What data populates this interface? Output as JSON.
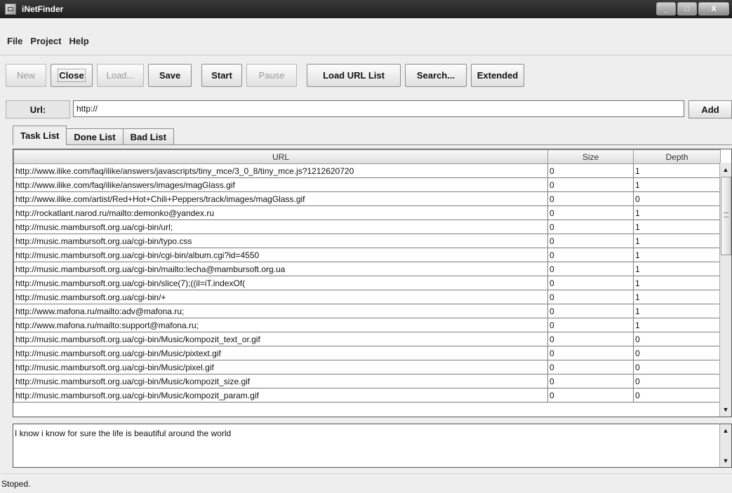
{
  "window": {
    "title": "iNetFinder",
    "minimize_glyph": "_",
    "maximize_glyph": "□",
    "close_glyph": "X"
  },
  "menu": [
    "File",
    "Project",
    "Help"
  ],
  "toolbar": {
    "new": "New",
    "close": "Close",
    "load": "Load...",
    "save": "Save",
    "start": "Start",
    "pause": "Pause",
    "load_url_list": "Load URL List",
    "search": "Search...",
    "extended": "Extended"
  },
  "url": {
    "label": "Url:",
    "value": "http://",
    "add": "Add"
  },
  "tabs": [
    "Task List",
    "Done List",
    "Bad List"
  ],
  "table": {
    "columns": [
      "URL",
      "Size",
      "Depth"
    ],
    "rows": [
      [
        "http://www.ilike.com/faq/ilike/answers/javascripts/tiny_mce/3_0_8/tiny_mce.js?1212620720",
        "0",
        "1"
      ],
      [
        "http://www.ilike.com/faq/ilike/answers/images/magGlass.gif",
        "0",
        "1"
      ],
      [
        "http://www.ilike.com/artist/Red+Hot+Chili+Peppers/track/images/magGlass.gif",
        "0",
        "0"
      ],
      [
        "http://rockatlant.narod.ru/mailto:demonko@yandex.ru",
        "0",
        "1"
      ],
      [
        "http://music.mambursoft.org.ua/cgi-bin/url;",
        "0",
        "1"
      ],
      [
        "http://music.mambursoft.org.ua/cgi-bin/typo.css",
        "0",
        "1"
      ],
      [
        "http://music.mambursoft.org.ua/cgi-bin/cgi-bin/album.cgi?id=4550",
        "0",
        "1"
      ],
      [
        "http://music.mambursoft.org.ua/cgi-bin/mailto:lecha@mambursoft.org.ua",
        "0",
        "1"
      ],
      [
        "http://music.mambursoft.org.ua/cgi-bin/slice(7);((il=iT.indexOf(",
        "0",
        "1"
      ],
      [
        "http://music.mambursoft.org.ua/cgi-bin/+",
        "0",
        "1"
      ],
      [
        "http://www.mafona.ru/mailto:adv@mafona.ru;",
        "0",
        "1"
      ],
      [
        "http://www.mafona.ru/mailto:support@mafona.ru;",
        "0",
        "1"
      ],
      [
        "http://music.mambursoft.org.ua/cgi-bin/Music/kompozit_text_or.gif",
        "0",
        "0"
      ],
      [
        "http://music.mambursoft.org.ua/cgi-bin/Music/pixtext.gif",
        "0",
        "0"
      ],
      [
        "http://music.mambursoft.org.ua/cgi-bin/Music/pixel.gif",
        "0",
        "0"
      ],
      [
        "http://music.mambursoft.org.ua/cgi-bin/Music/kompozit_size.gif",
        "0",
        "0"
      ],
      [
        "http://music.mambursoft.org.ua/cgi-bin/Music/kompozit_param.gif",
        "0",
        "0"
      ]
    ]
  },
  "log": "I know i know for sure the life is beautiful around the world",
  "status": "Stoped."
}
